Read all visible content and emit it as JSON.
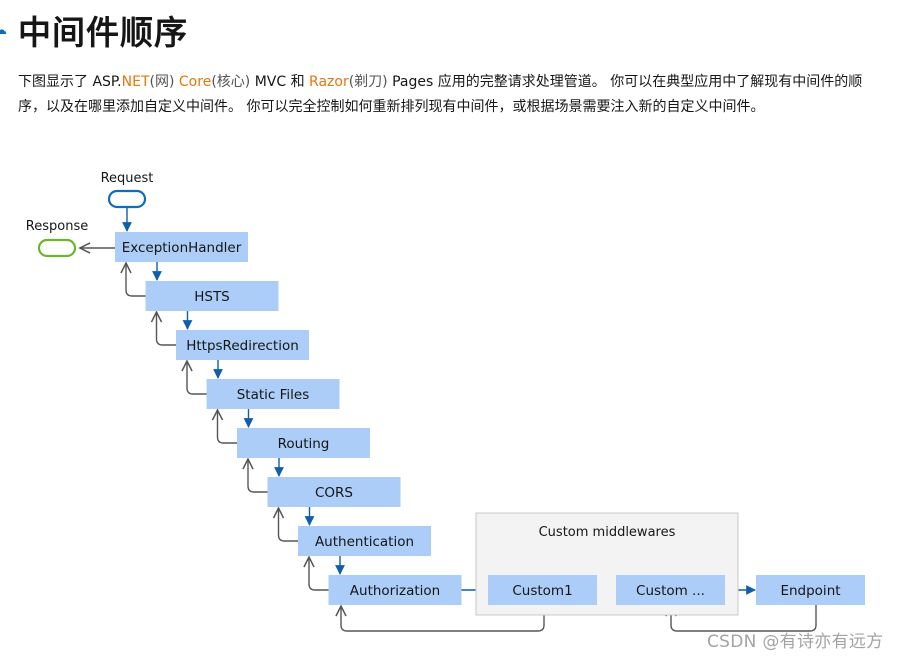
{
  "page": {
    "heading": "中间件顺序",
    "heading_icon": "link-icon",
    "paragraph": {
      "segments": [
        {
          "text": "下图显示了 ASP.",
          "style": "normal"
        },
        {
          "text": "NET",
          "style": "highlight"
        },
        {
          "text": "(网)",
          "style": "gloss"
        },
        {
          "text": " ",
          "style": "normal"
        },
        {
          "text": "Core",
          "style": "highlight"
        },
        {
          "text": "(核心)",
          "style": "gloss"
        },
        {
          "text": " MVC 和 ",
          "style": "normal"
        },
        {
          "text": "Razor",
          "style": "highlight"
        },
        {
          "text": "(剃刀)",
          "style": "gloss"
        },
        {
          "text": " Pages 应用的完整请求处理管道。 你可以在典型应用中了解现有中间件的顺序，以及在哪里添加自定义中间件。 你可以完全控制如何重新排列现有中间件，或根据场景需要注入新的自定义中间件。",
          "style": "normal"
        }
      ]
    }
  },
  "diagram": {
    "request_label": "Request",
    "response_label": "Response",
    "pipeline": [
      "ExceptionHandler",
      "HSTS",
      "HttpsRedirection",
      "Static Files",
      "Routing",
      "CORS",
      "Authentication",
      "Authorization"
    ],
    "custom_group_label": "Custom middlewares",
    "custom": [
      "Custom1",
      "Custom ..."
    ],
    "endpoint": "Endpoint",
    "colors": {
      "box_fill": "#abcdf7",
      "forward_arrow": "#0f5fa8",
      "return_arrow": "#555555",
      "request_ellipse": "#0f6cbd",
      "response_ellipse": "#6bb42d",
      "group_fill": "#f3f3f3",
      "group_border": "#c8c8c8",
      "highlight_text": "#e8760a"
    }
  },
  "watermark": "CSDN @有诗亦有远方"
}
